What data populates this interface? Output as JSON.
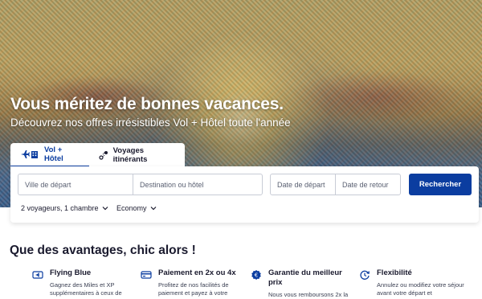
{
  "hero": {
    "title": "Vous méritez de bonnes vacances.",
    "subtitle": "Découvrez nos offres irrésistibles Vol + Hôtel toute l'année"
  },
  "tabs": [
    {
      "label": "Vol + Hôtel",
      "icon": "plane-hotel-icon",
      "active": true
    },
    {
      "label": "Voyages itinérants",
      "icon": "route-icon",
      "active": false
    }
  ],
  "search": {
    "departure_placeholder": "Ville de départ",
    "destination_placeholder": "Destination ou hôtel",
    "date_departure_placeholder": "Date de départ",
    "date_return_placeholder": "Date de retour",
    "button_label": "Rechercher",
    "passengers": "2 voyageurs, 1 chambre",
    "cabin": "Economy"
  },
  "advantages": {
    "title": "Que des avantages, chic alors !",
    "items": [
      {
        "name": "Flying Blue",
        "icon": "card-icon",
        "description": "Gagnez des Miles et XP supplémentaires à ceux de"
      },
      {
        "name": "Paiement en 2x ou 4x",
        "icon": "credit-card-icon",
        "description": "Profitez de nos facilités de paiement et payez à votre"
      },
      {
        "name": "Garantie du meilleur prix",
        "icon": "euro-badge-icon",
        "description": "Nous vous remboursons 2x la"
      },
      {
        "name": "Flexibilité",
        "icon": "flexibility-icon",
        "description": "Annulez ou modifiez votre séjour avant votre départ et"
      }
    ]
  },
  "colors": {
    "accent": "#0b3da0",
    "text": "#1a1a2e"
  }
}
